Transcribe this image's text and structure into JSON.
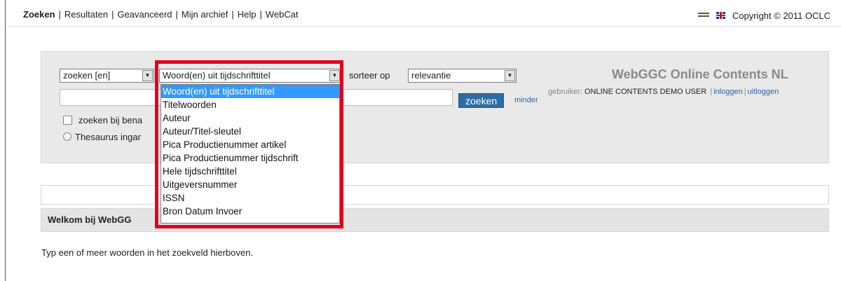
{
  "nav": {
    "items": [
      "Zoeken",
      "Resultaten",
      "Geavanceerd",
      "Mijn archief",
      "Help",
      "WebCat"
    ],
    "separator": "|",
    "copyright": "Copyright © 2011 OCLC"
  },
  "search": {
    "operator_value": "zoeken [en]",
    "field_value": "Woord(en) uit tijdschrifttitel",
    "sort_label": "sorteer op",
    "sort_value": "relevantie",
    "query_value": "",
    "button_label": "zoeken",
    "less_link": "minder",
    "checkbox_label": "zoeken bij bena",
    "radio_label": "Thesaurus ingar"
  },
  "field_options": [
    "Woord(en) uit tijdschrifttitel",
    "Titelwoorden",
    "Auteur",
    "Auteur/Titel-sleutel",
    "Pica Productienummer artikel",
    "Pica Productienummer tijdschrift",
    "Hele tijdschrifttitel",
    "Uitgeversnummer",
    "ISSN",
    "Bron Datum Invoer"
  ],
  "brand": {
    "title": "WebGGC Online Contents NL",
    "user_prefix": "gebruiker:",
    "user_name": "ONLINE CONTENTS DEMO USER",
    "login": "inloggen",
    "logout": "uitloggen",
    "sep": "|"
  },
  "content": {
    "welcome": "Welkom bij WebGG",
    "hint": "Typ een of meer woorden in het zoekveld hierboven."
  },
  "colors": {
    "highlight_border": "#e3001b",
    "selected_option": "#3399ff",
    "button": "#2e6da4",
    "link": "#2f63a3"
  },
  "icons": [
    "menu-icon",
    "uk-flag-icon",
    "dropdown-arrow-icon"
  ]
}
